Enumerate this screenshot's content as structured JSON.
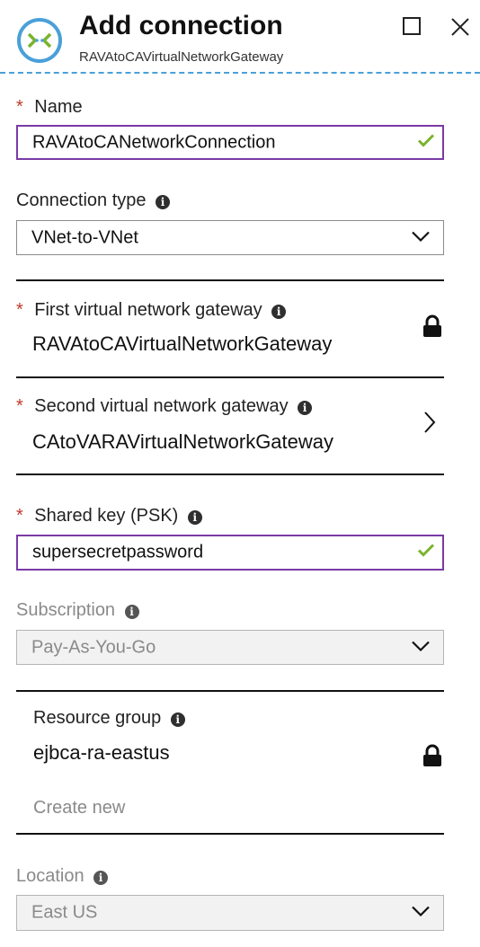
{
  "header": {
    "title": "Add connection",
    "subtitle": "RAVAtoCAVirtualNetworkGateway",
    "icon": "vpn-connection-icon",
    "accent": "#4aa0d8"
  },
  "form": {
    "name": {
      "label": "Name",
      "value": "RAVAtoCANetworkConnection"
    },
    "connection_type": {
      "label": "Connection type",
      "value": "VNet-to-VNet"
    },
    "first_gateway": {
      "label": "First virtual network gateway",
      "value": "RAVAtoCAVirtualNetworkGateway"
    },
    "second_gateway": {
      "label": "Second virtual network gateway",
      "value": "CAtoVARAVirtualNetworkGateway"
    },
    "shared_key": {
      "label": "Shared key (PSK)",
      "value": "supersecretpassword"
    },
    "subscription": {
      "label": "Subscription",
      "value": "Pay-As-You-Go"
    },
    "resource_group": {
      "label": "Resource group",
      "value": "ejbca-ra-eastus",
      "create_new": "Create new"
    },
    "location": {
      "label": "Location",
      "value": "East US"
    }
  },
  "colors": {
    "required": "#c0392b",
    "valid": "#7ab32e",
    "focus_border": "#7a3aa6"
  }
}
